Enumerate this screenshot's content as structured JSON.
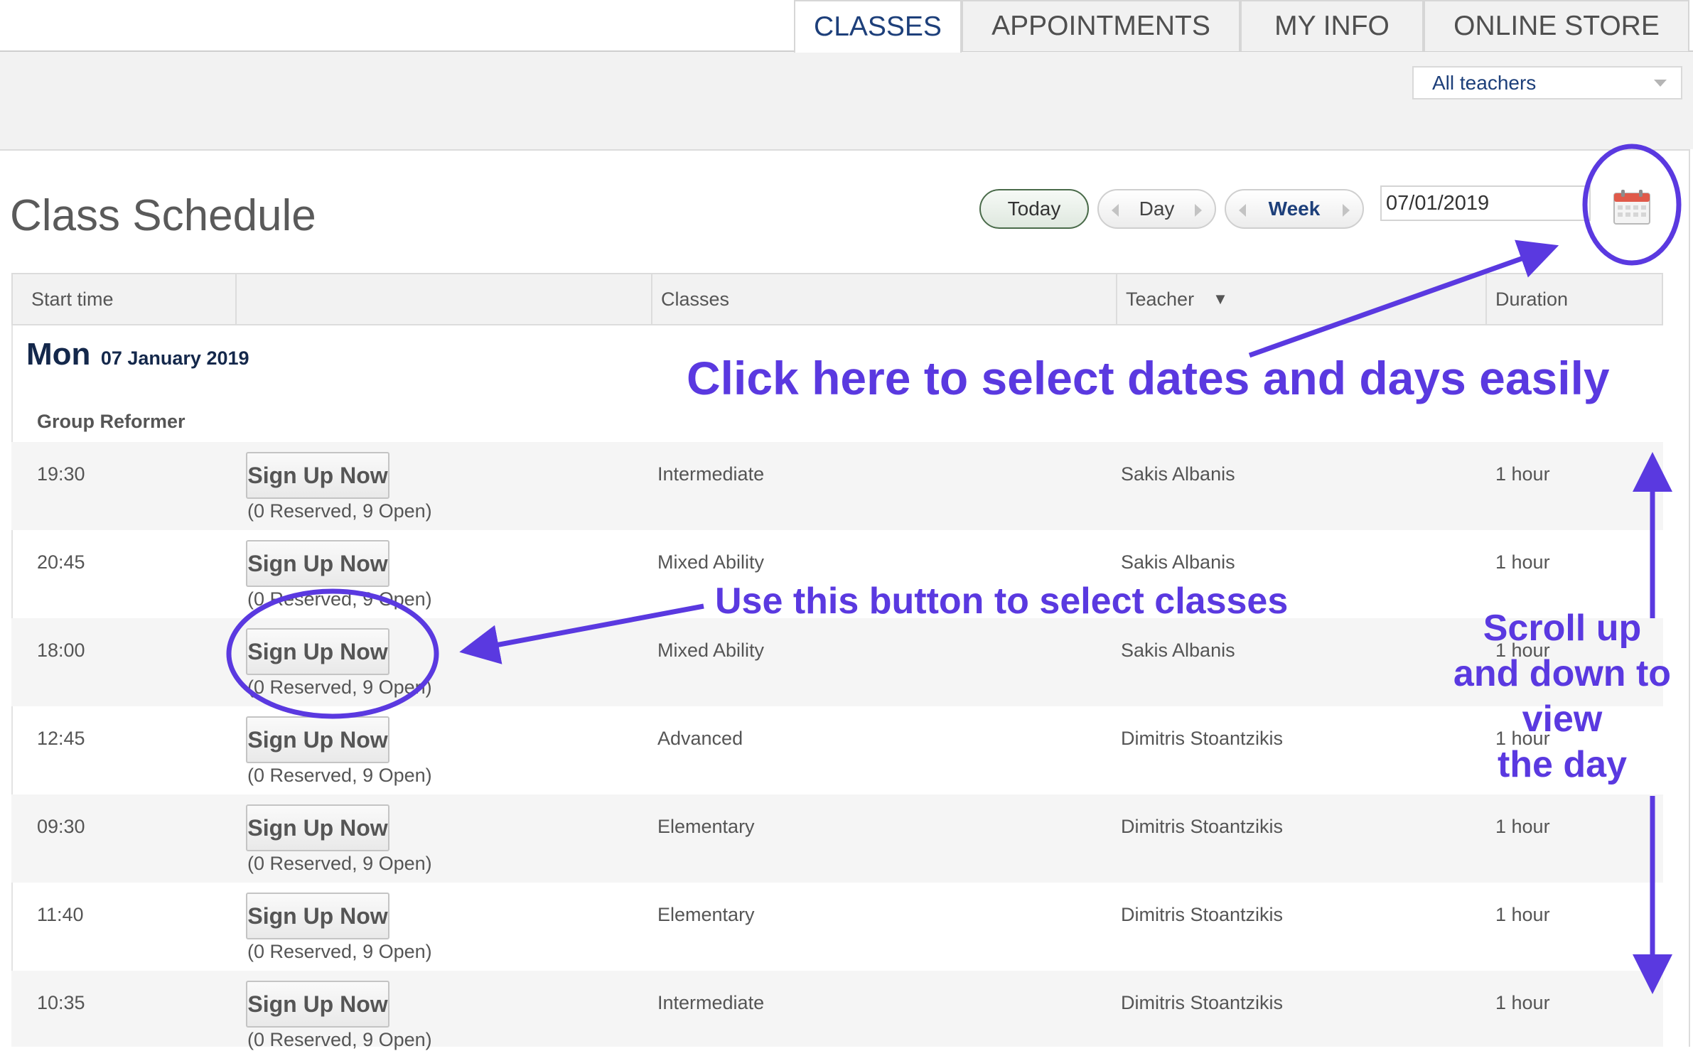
{
  "nav": {
    "tabs": [
      {
        "label": "CLASSES",
        "active": true
      },
      {
        "label": "APPOINTMENTS",
        "active": false
      },
      {
        "label": "MY INFO",
        "active": false
      },
      {
        "label": "ONLINE STORE",
        "active": false
      }
    ]
  },
  "filter": {
    "teacher_select": "All teachers"
  },
  "schedule": {
    "title": "Class Schedule",
    "today_label": "Today",
    "day_label": "Day",
    "week_label": "Week",
    "date_value": "07/01/2019",
    "calendar_icon": "calendar-icon"
  },
  "table": {
    "headers": {
      "start": "Start time",
      "classes": "Classes",
      "teacher": "Teacher",
      "teacher_sort": "▼",
      "duration": "Duration"
    },
    "day": {
      "name": "Mon",
      "date": "07 January 2019"
    },
    "group": "Group Reformer",
    "signup_label": "Sign Up Now",
    "rows": [
      {
        "time": "19:30",
        "availability": "(0 Reserved, 9 Open)",
        "class": "Intermediate",
        "teacher": "Sakis Albanis",
        "duration": "1 hour"
      },
      {
        "time": "20:45",
        "availability": "(0 Reserved, 9 Open)",
        "class": "Mixed Ability",
        "teacher": "Sakis Albanis",
        "duration": "1 hour"
      },
      {
        "time": "18:00",
        "availability": "(0 Reserved, 9 Open)",
        "class": "Mixed Ability",
        "teacher": "Sakis Albanis",
        "duration": "1 hour"
      },
      {
        "time": "12:45",
        "availability": "(0 Reserved, 9 Open)",
        "class": "Advanced",
        "teacher": "Dimitris Stoantzikis",
        "duration": "1 hour"
      },
      {
        "time": "09:30",
        "availability": "(0 Reserved, 9 Open)",
        "class": "Elementary",
        "teacher": "Dimitris Stoantzikis",
        "duration": "1 hour"
      },
      {
        "time": "11:40",
        "availability": "(0 Reserved, 9 Open)",
        "class": "Elementary",
        "teacher": "Dimitris Stoantzikis",
        "duration": "1 hour"
      },
      {
        "time": "10:35",
        "availability": "(0 Reserved, 9 Open)",
        "class": "Intermediate",
        "teacher": "Dimitris Stoantzikis",
        "duration": "1 hour"
      }
    ]
  },
  "annotations": {
    "calendar_tip": "Click here to select dates and days easily",
    "button_tip": "Use this button to select classes",
    "scroll_tip": [
      "Scroll up",
      "and down to",
      "view",
      "the day"
    ],
    "color": "#5a39e0"
  }
}
